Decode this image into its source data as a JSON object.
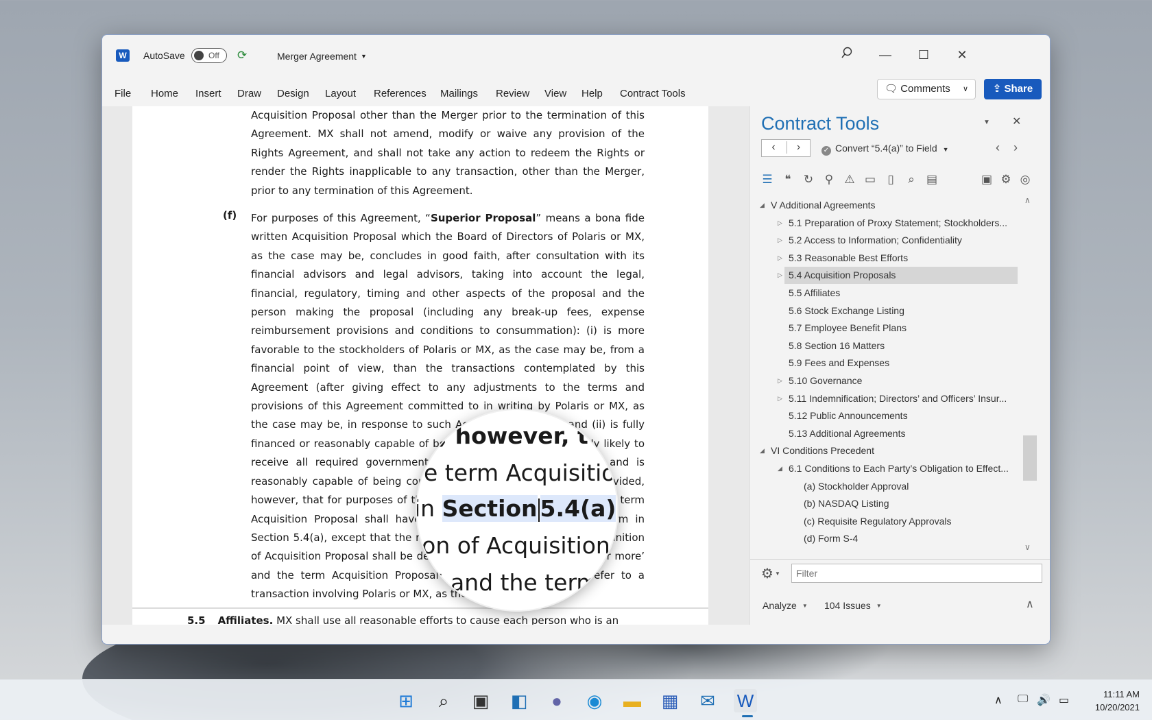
{
  "titlebar": {
    "autosave_label": "AutoSave",
    "autosave_state": "Off",
    "document_title": "Merger Agreement"
  },
  "menu": [
    "File",
    "Home",
    "Insert",
    "Draw",
    "Design",
    "Layout",
    "References",
    "Mailings",
    "Review",
    "View",
    "Help",
    "Contract Tools"
  ],
  "buttons": {
    "comments": "Comments",
    "share": "Share"
  },
  "document": {
    "para_top": "Acquisition Proposal other than the Merger prior to the termination of this Agreement. MX shall not amend, modify or waive any provision of the Rights Agreement, and shall not take any action to redeem the Rights or render the Rights inapplicable to any transaction, other than the Merger, prior to any termination of this Agreement.",
    "para_f_label": "(f)",
    "para_f_1": "For purposes of this Agreement, “",
    "para_f_term": "Superior Proposal",
    "para_f_2": "” means a bona fide written Acquisition Proposal which the Board of Directors of Polaris or MX, as the case may be, concludes in good faith, after consultation with its financial advisors and legal advisors, taking into account the legal, financial, regulatory, timing and other aspects of the proposal and the person making the proposal (including any break-up fees, expense reimbursement provisions and conditions to consummation): (i) is more favorable to the stockholders of Polaris or MX, as the case may be, from a financial point of view, than the transactions contemplated by this Agreement (after giving effect to any adjustments to the terms and provisions of this Agreement committed to in writing by Polaris or MX, as the case may be, in response to such Acquisition Proposal) and (ii) is fully financed or reasonably capable of being fully financed, reasonably likely to receive all required governmental approvals on a timely basis and is reasonably capable of being completed on the terms proposed; provided, however, that for purposes of this definition of Superior Proposal, the term Acquisition Proposal shall have the meaning assigned to such term in Section 5.4(a), except that the reference to ‘15% or more’ in the definition of Acquisition Proposal shall be deemed to be a reference to ‘50% or more’ and the term Acquisition Proposal shall only be deemed to refer to a transaction involving Polaris or MX, as the case may be.",
    "sec55_num": "5.5",
    "sec55_heading": "Affiliates.",
    "sec55_text": " MX shall use all reasonable efforts to cause each person who is an"
  },
  "magnifier": {
    "line1": "d, however, t",
    "line2": "e term Acquisition",
    "line3_pre": "in ",
    "line3_hl1": "Section",
    "line3_hl2": "5.4(a)",
    "line3_post": ", e",
    "line4": "ion of Acquisition",
    "line5": "’ and the term"
  },
  "panel": {
    "title": "Contract Tools",
    "convert_label": "Convert “5.4(a)” to Field",
    "filter_placeholder": "Filter",
    "analyze_label": "Analyze",
    "issues_label": "104 Issues",
    "tree": [
      {
        "label": "V Additional Agreements",
        "level": 0,
        "expander": "open"
      },
      {
        "label": "5.1 Preparation of Proxy Statement; Stockholders...",
        "level": 1,
        "expander": "closed"
      },
      {
        "label": "5.2 Access to Information; Confidentiality",
        "level": 1,
        "expander": "closed"
      },
      {
        "label": "5.3 Reasonable Best Efforts",
        "level": 1,
        "expander": "closed"
      },
      {
        "label": "5.4 Acquisition Proposals",
        "level": 1,
        "expander": "closed",
        "selected": true
      },
      {
        "label": "5.5 Affiliates",
        "level": 1,
        "expander": "none"
      },
      {
        "label": "5.6 Stock Exchange Listing",
        "level": 1,
        "expander": "none"
      },
      {
        "label": "5.7 Employee Benefit Plans",
        "level": 1,
        "expander": "none"
      },
      {
        "label": "5.8 Section 16 Matters",
        "level": 1,
        "expander": "none"
      },
      {
        "label": "5.9 Fees and Expenses",
        "level": 1,
        "expander": "none"
      },
      {
        "label": "5.10 Governance",
        "level": 1,
        "expander": "closed"
      },
      {
        "label": "5.11 Indemnification; Directors’ and Officers’ Insur...",
        "level": 1,
        "expander": "closed"
      },
      {
        "label": "5.12 Public Announcements",
        "level": 1,
        "expander": "none"
      },
      {
        "label": "5.13 Additional Agreements",
        "level": 1,
        "expander": "none"
      },
      {
        "label": "VI Conditions Precedent",
        "level": 0,
        "expander": "open"
      },
      {
        "label": "6.1 Conditions to Each Party’s Obligation to Effect...",
        "level": 1,
        "expander": "open"
      },
      {
        "label": "(a) Stockholder Approval",
        "level": 2,
        "expander": "none"
      },
      {
        "label": "(b) NASDAQ Listing",
        "level": 2,
        "expander": "none"
      },
      {
        "label": "(c) Requisite Regulatory Approvals",
        "level": 2,
        "expander": "none"
      },
      {
        "label": "(d) Form S-4",
        "level": 2,
        "expander": "none"
      }
    ]
  },
  "taskbar": {
    "time": "11:11 AM",
    "date": "10/20/2021"
  },
  "colors": {
    "accent": "#185abd",
    "panel_title": "#1f6fb4",
    "highlight": "#dde8fb"
  }
}
